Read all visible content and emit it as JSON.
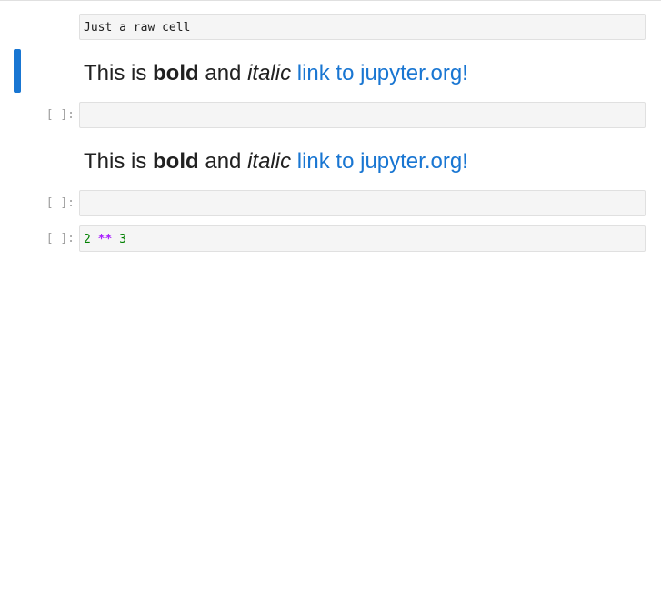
{
  "raw_cell": {
    "text": "Just a raw cell"
  },
  "markdown_cells": [
    {
      "prefix": "This is ",
      "bold": "bold",
      "middle": " and ",
      "italic": "italic",
      "space": " ",
      "link_text": "link to jupyter.org!"
    },
    {
      "prefix": "This is ",
      "bold": "bold",
      "middle": " and ",
      "italic": "italic",
      "space": " ",
      "link_text": "link to jupyter.org!"
    }
  ],
  "code_cells": [
    {
      "prompt": "[ ]:",
      "code": ""
    },
    {
      "prompt": "[ ]:",
      "code": ""
    },
    {
      "prompt": "[ ]:",
      "tokens": {
        "num1": "2",
        "op": "**",
        "num2": "3"
      }
    }
  ],
  "colors": {
    "active_indicator": "#1976d2",
    "link": "#1976d2",
    "cell_background": "#f5f5f5",
    "number_token": "#008000",
    "operator_token": "#aa22ff"
  }
}
